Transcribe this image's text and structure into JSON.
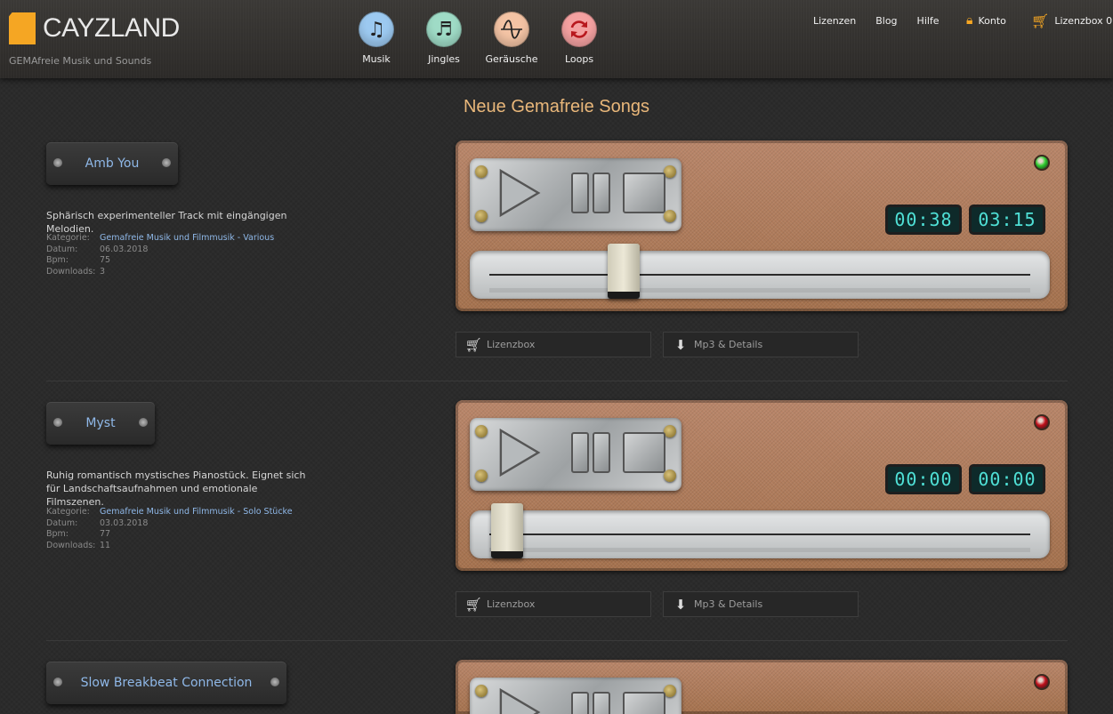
{
  "header": {
    "logo_text": "CAYZLAND",
    "tagline": "GEMAfreie Musik und Sounds",
    "categories": [
      {
        "label": "Musik",
        "icon": "music-note-icon",
        "color": "#9cc9f0"
      },
      {
        "label": "Jingles",
        "icon": "music-notes-icon",
        "color": "#9fdbc6"
      },
      {
        "label": "Geräusche",
        "icon": "wave-icon",
        "color": "#f3c3a4"
      },
      {
        "label": "Loops",
        "icon": "loop-icon",
        "color": "#f4a1a1"
      }
    ],
    "nav": [
      "Lizenzen",
      "Blog",
      "Hilfe"
    ],
    "account_label": "Konto",
    "cart_label": "Lizenzbox 0"
  },
  "page_title": "Neue Gemafreie Songs",
  "songs": [
    {
      "title": "Amb You",
      "description": "Sphärisch experimenteller Track mit eingängigen Melodien.",
      "meta": {
        "kategorie_label": "Kategorie:",
        "kategorie": "Gemafreie Musik und Filmmusik - Various",
        "datum_label": "Datum:",
        "datum": "06.03.2018",
        "bpm_label": "Bpm:",
        "bpm": "75",
        "downloads_label": "Downloads:",
        "downloads": "3"
      },
      "time_elapsed": "00:38",
      "time_total": "03:15",
      "progress": 0.23,
      "led": "green",
      "lizenzbox_label": "Lizenzbox",
      "details_label": "Mp3 & Details"
    },
    {
      "title": "Myst",
      "description": "Ruhig romantisch mystisches Pianostück. Eignet sich für Landschaftsaufnahmen und emotionale Filmszenen.",
      "meta": {
        "kategorie_label": "Kategorie:",
        "kategorie": "Gemafreie Musik und Filmmusik - Solo Stücke",
        "datum_label": "Datum:",
        "datum": "03.03.2018",
        "bpm_label": "Bpm:",
        "bpm": "77",
        "downloads_label": "Downloads:",
        "downloads": "11"
      },
      "time_elapsed": "00:00",
      "time_total": "00:00",
      "progress": 0,
      "led": "red",
      "lizenzbox_label": "Lizenzbox",
      "details_label": "Mp3 & Details"
    },
    {
      "title": "Slow Breakbeat Connection",
      "led": "red"
    }
  ],
  "colors": {
    "accent_orange": "#f5a623",
    "title_color": "#e9b77a",
    "link_blue": "#8fb8e8",
    "led_green": "#2ecc2e",
    "led_red": "#c0101a",
    "display_text": "#4fe0d6"
  }
}
